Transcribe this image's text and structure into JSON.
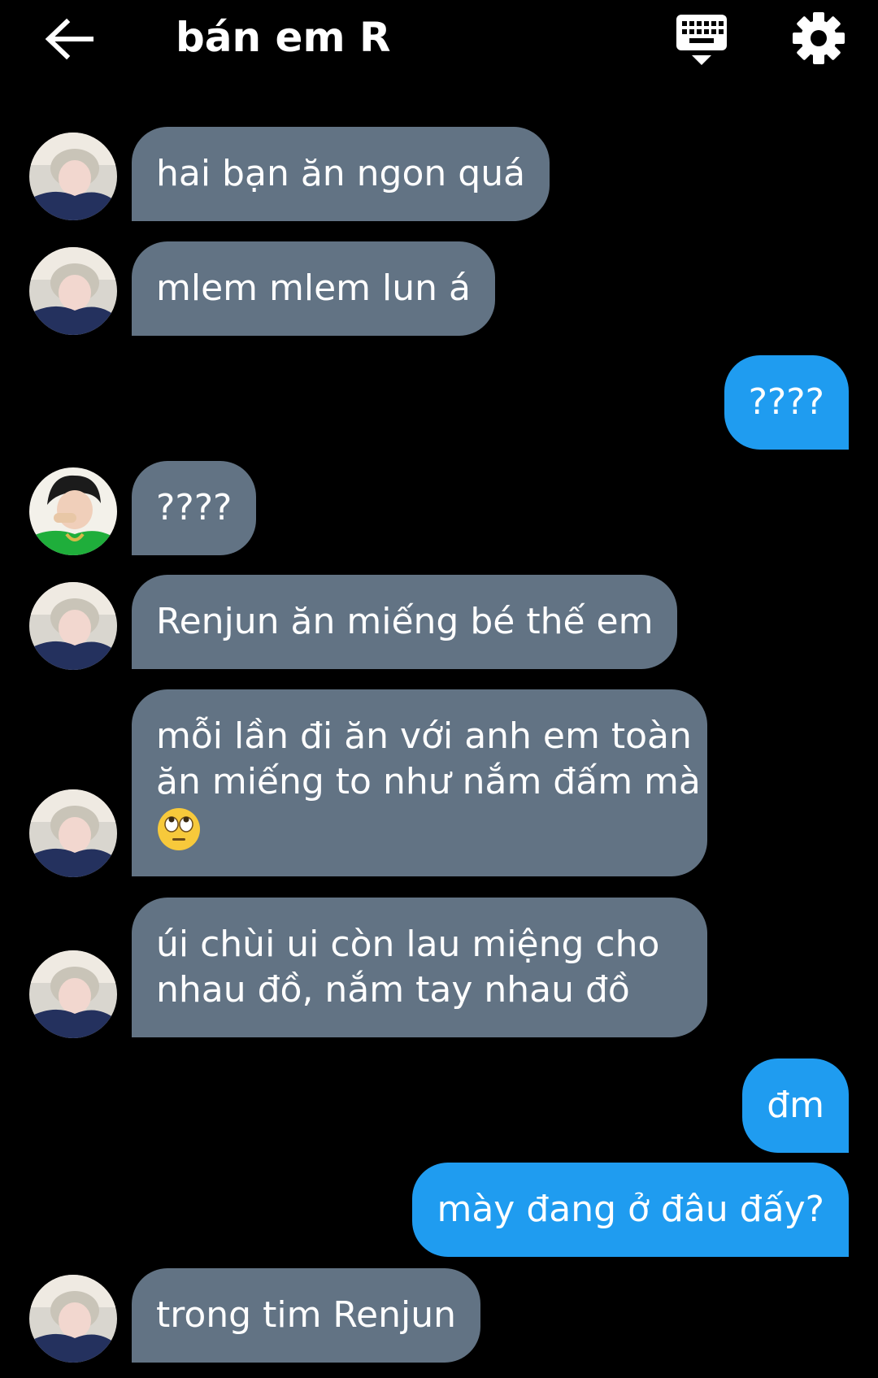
{
  "header": {
    "back_icon": "arrow-left-icon",
    "title": "bán em R",
    "keyboard_icon": "keyboard-hide-icon",
    "settings_icon": "gear-icon"
  },
  "colors": {
    "background": "#000000",
    "incoming_bubble": "#627384",
    "outgoing_bubble": "#1f9cf0",
    "text": "#ffffff"
  },
  "messages": [
    {
      "direction": "incoming",
      "avatar": "avatar-light-hair",
      "text": "hai bạn ăn ngon quá"
    },
    {
      "direction": "incoming",
      "avatar": "avatar-light-hair",
      "text": "mlem mlem lun á"
    },
    {
      "direction": "outgoing",
      "text": "????"
    },
    {
      "direction": "incoming",
      "avatar": "avatar-dark-hair-green-jacket",
      "text": "????"
    },
    {
      "direction": "incoming",
      "avatar": "avatar-light-hair",
      "text": "Renjun ăn miếng bé thế em"
    },
    {
      "direction": "incoming",
      "avatar": "avatar-light-hair",
      "lines": [
        "mỗi lần đi ăn với anh em toàn",
        "ăn miếng to như nắm đấm mà"
      ],
      "emoji": "eye-roll-emoji"
    },
    {
      "direction": "incoming",
      "avatar": "avatar-light-hair",
      "lines": [
        "úi chùi ui còn lau miệng cho",
        "nhau đồ, nắm tay nhau đồ"
      ]
    },
    {
      "direction": "outgoing",
      "text": "đm"
    },
    {
      "direction": "outgoing",
      "text": "mày đang ở đâu đấy?"
    },
    {
      "direction": "incoming",
      "avatar": "avatar-light-hair",
      "text": "trong tim Renjun"
    }
  ]
}
